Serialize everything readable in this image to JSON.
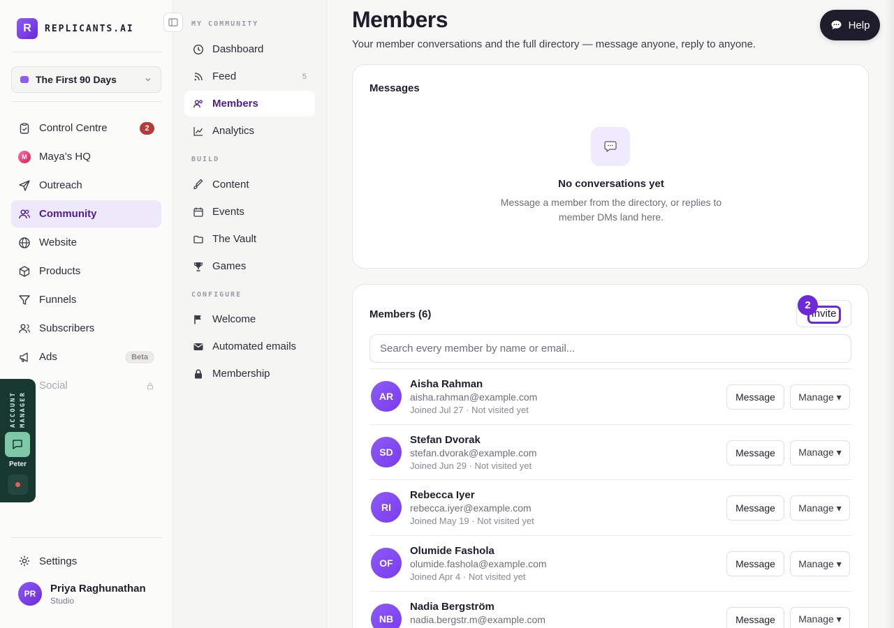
{
  "brand": {
    "logo_letter": "R",
    "name": "REPLICANTS.AI",
    "accent": "#7c3aed"
  },
  "space": {
    "name": "The First 90 Days"
  },
  "nav": {
    "items": [
      {
        "label": "Control Centre",
        "badge": "2",
        "icon": "clipboard-icon"
      },
      {
        "label": "Maya’s HQ",
        "icon": "maya-logo-icon"
      },
      {
        "label": "Outreach",
        "icon": "send-icon"
      },
      {
        "label": "Community",
        "icon": "users-icon",
        "active": true
      },
      {
        "label": "Website",
        "icon": "globe-icon"
      },
      {
        "label": "Products",
        "icon": "box-icon"
      },
      {
        "label": "Funnels",
        "icon": "funnel-icon"
      },
      {
        "label": "Subscribers",
        "icon": "subscribers-icon"
      },
      {
        "label": "Ads",
        "badge": "Beta",
        "icon": "megaphone-icon"
      },
      {
        "label": "Social",
        "icon": "social-icon",
        "locked": true
      }
    ],
    "settings": "Settings"
  },
  "user": {
    "initials": "PR",
    "name": "Priya Raghunathan",
    "role": "Studio"
  },
  "account_manager": {
    "label": "ACCOUNT MANAGER",
    "name": "Peter"
  },
  "sub_nav": {
    "sections": [
      {
        "title": "MY COMMUNITY",
        "items": [
          {
            "label": "Dashboard",
            "icon": "clock-icon"
          },
          {
            "label": "Feed",
            "icon": "rss-icon",
            "count": "5"
          },
          {
            "label": "Members",
            "icon": "members-icon",
            "active": true
          },
          {
            "label": "Analytics",
            "icon": "chart-icon"
          }
        ]
      },
      {
        "title": "BUILD",
        "items": [
          {
            "label": "Content",
            "icon": "brush-icon"
          },
          {
            "label": "Events",
            "icon": "calendar-icon"
          },
          {
            "label": "The Vault",
            "icon": "folder-icon"
          },
          {
            "label": "Games",
            "icon": "trophy-icon"
          }
        ]
      },
      {
        "title": "CONFIGURE",
        "items": [
          {
            "label": "Welcome",
            "icon": "flag-icon"
          },
          {
            "label": "Automated emails",
            "icon": "mail-icon"
          },
          {
            "label": "Membership",
            "icon": "lock-icon"
          }
        ]
      }
    ]
  },
  "page": {
    "title": "Members",
    "subtitle": "Your member conversations and the full directory — message anyone, reply to anyone.",
    "help_label": "Help"
  },
  "messages": {
    "title": "Messages",
    "empty_title": "No conversations yet",
    "empty_subtitle": "Message a member from the directory, or replies to member DMs land here."
  },
  "members": {
    "title": "Members (6)",
    "invite_label": "Invite",
    "step_badge": "2",
    "search_placeholder": "Search every member by name or email...",
    "message_label": "Message",
    "manage_label": "Manage ▾",
    "rows": [
      {
        "initials": "AR",
        "name": "Aisha Rahman",
        "email": "aisha.rahman@example.com",
        "meta": "Joined Jul 27 · Not visited yet"
      },
      {
        "initials": "SD",
        "name": "Stefan Dvorak",
        "email": "stefan.dvorak@example.com",
        "meta": "Joined Jun 29 · Not visited yet"
      },
      {
        "initials": "RI",
        "name": "Rebecca Iyer",
        "email": "rebecca.iyer@example.com",
        "meta": "Joined May 19 · Not visited yet"
      },
      {
        "initials": "OF",
        "name": "Olumide Fashola",
        "email": "olumide.fashola@example.com",
        "meta": "Joined Apr 4 · Not visited yet"
      },
      {
        "initials": "NB",
        "name": "Nadia Bergström",
        "email": "nadia.bergstr.m@example.com",
        "meta": ""
      }
    ]
  }
}
